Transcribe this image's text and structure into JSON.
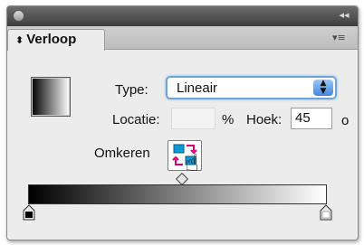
{
  "panel": {
    "tab_label": "Verloop",
    "tab_arrows": "⬍",
    "collapse_icon": "◂◂",
    "menu_icon": "▾≡"
  },
  "gradient": {
    "type_label": "Type:",
    "type_value": "Lineair",
    "location_label": "Locatie:",
    "location_value": "",
    "percent_unit": "%",
    "angle_label": "Hoek:",
    "angle_value": "45",
    "angle_unit": "o",
    "reverse_label": "Omkeren",
    "start_color": "#000000",
    "end_color": "#ffffff"
  },
  "colors": {
    "select_focus": "#6fa3dc",
    "arrow_blue": "#3f86e0",
    "reverse_magenta": "#d6006e",
    "reverse_cyan": "#0a9ad6"
  }
}
